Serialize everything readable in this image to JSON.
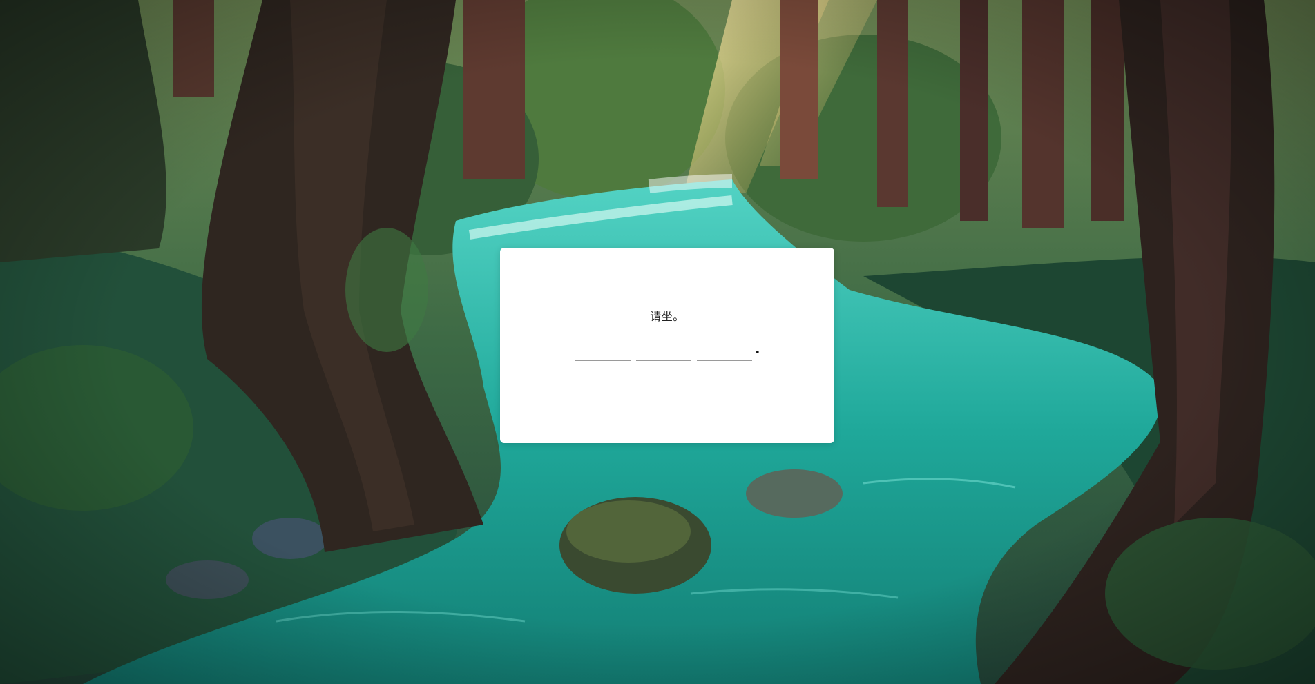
{
  "background": {
    "description_icon": "forest-river-landscape",
    "colors": {
      "water": "#1fa89a",
      "water_dark": "#0e6e66",
      "foliage": "#2e5a3a",
      "trunk": "#3a2a25",
      "sunlight": "#f6d27a"
    }
  },
  "dialog": {
    "prompt": "请坐。",
    "blanks": [
      {
        "value": "",
        "placeholder": ""
      },
      {
        "value": "",
        "placeholder": ""
      },
      {
        "value": "",
        "placeholder": ""
      }
    ],
    "terminator": "."
  }
}
